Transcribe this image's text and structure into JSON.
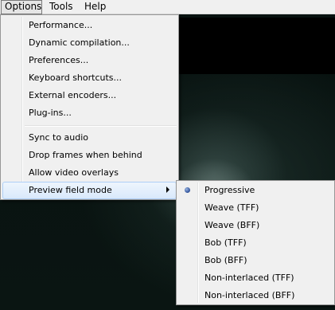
{
  "menubar": {
    "options": "Options",
    "tools": "Tools",
    "help": "Help"
  },
  "options_menu": {
    "items": [
      "Performance...",
      "Dynamic compilation...",
      "Preferences...",
      "Keyboard shortcuts...",
      "External encoders...",
      "Plug-ins...",
      "Sync to audio",
      "Drop frames when behind",
      "Allow video overlays",
      "Preview field mode"
    ]
  },
  "preview_field_mode_submenu": {
    "selected": "Progressive",
    "items": [
      "Progressive",
      "Weave (TFF)",
      "Weave (BFF)",
      "Bob (TFF)",
      "Bob (BFF)",
      "Non-interlaced (TFF)",
      "Non-interlaced (BFF)"
    ]
  },
  "icons": {
    "submenu_arrow": "chevron-right-icon",
    "selected_option": "radio-bullet-icon"
  }
}
